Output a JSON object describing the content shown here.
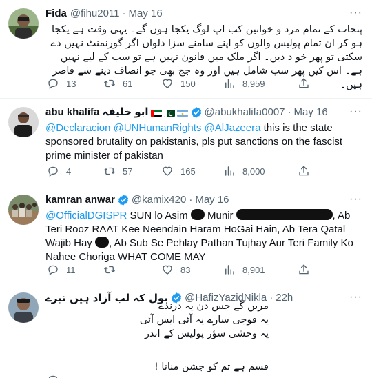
{
  "tweets": [
    {
      "name": "Fida",
      "handle": "@fihu2011",
      "dot": "·",
      "date": "May 16",
      "text": "پنجاب کے تمام مرد و خواتین کب اپ لوگ یکجا ہوں گے۔ یہی وقت ہے یکجا ہو کر ان تمام پولیس والوں کو اپنے سامنے سزا دلواں اگر گورنمنٹ نہیں دے سکتی تو پھر خو د دیں۔ اگر ملک میں قانون نہیں ہے تو سب کے لیے نہیں ہے۔ اس کیں پھر سب شامل ہیں اور وہ جج بھی جو انصاف دینے سے قاصر ہیں۔",
      "stats": {
        "replies": "13",
        "retweets": "61",
        "likes": "150",
        "views": "8,959"
      }
    },
    {
      "name": "abu khalifa ابو خلیفہ",
      "handle": "@abukhalifa0007",
      "dot": "·",
      "date": "May 16",
      "mentions": "@Declaracion @UNHumanRights @AlJazeera",
      "text": " this is the state sponsored brutality on pakistanis, pls put sanctions on the fascist prime minister of pakistan",
      "stats": {
        "replies": "4",
        "retweets": "57",
        "likes": "165",
        "views": "8,000"
      }
    },
    {
      "name": "kamran anwar",
      "handle": "@kamix420",
      "dot": "·",
      "date": "May 16",
      "mention": "@OfficialDGISPR",
      "text_a": " SUN lo Asim ",
      "text_b": " Munir",
      "text_c": ", Ab Teri Rooz RAAT Kee Neendain Haram HoGai Hain, Ab Tera Qatal Wajib Hay ",
      "text_d": ", Ab Sub Se Pehlay Pathan Tujhay Aur Teri Family Ko Nahee Choriga WHAT COME MAY",
      "stats": {
        "replies": "11",
        "retweets": "",
        "likes": "83",
        "views": "8,901"
      }
    },
    {
      "name": "بول کہ لب آزاد ہیں تیرے",
      "handle": "@HafizYazidNikla",
      "dot": "·",
      "date": "22h",
      "lines": [
        "مریں گے جس دن یہ درندے",
        "یہ فوجی سارے یہ آئی ایس آئی",
        "یہ وحشی سؤر پولیس کے اندر",
        "",
        "قسم ہے تم کو جشن منانا !"
      ]
    }
  ],
  "colors": {
    "accent": "#1d9bf0",
    "muted": "#536471",
    "text": "#0f1419",
    "divider": "#eff3f4"
  },
  "icons": [
    "reply-icon",
    "retweet-icon",
    "like-icon",
    "views-icon",
    "share-icon",
    "verified-icon",
    "more-icon"
  ]
}
